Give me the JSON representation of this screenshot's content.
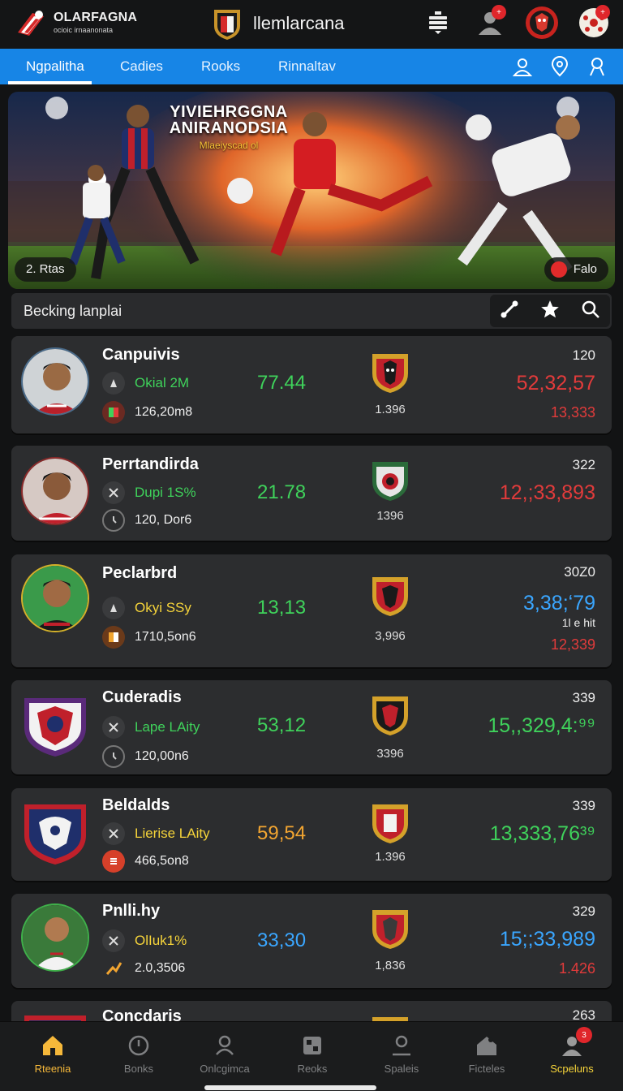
{
  "header": {
    "logo_title": "OLARFAGNA",
    "logo_subtitle": "ocioic irnaanonata",
    "brand_title": "llemlarcana",
    "icons": [
      "menu-stack-icon",
      "user-icon",
      "team-crest-icon",
      "ball-icon"
    ],
    "notification_badges": [
      "+",
      "+"
    ]
  },
  "tabs": {
    "items": [
      "Ngpalitha",
      "Cadies",
      "Rooks",
      "Rinnaltav"
    ],
    "active_index": 0,
    "icons": [
      "user-outline-icon",
      "location-icon",
      "profile-icon"
    ]
  },
  "banner": {
    "headline_1": "YIVIEHRGGNA",
    "headline_2": "ANIRANODSIA",
    "subline": "Mlaeiyscad ol",
    "left_pill": "2. Rtas",
    "right_pill": "Falo"
  },
  "section": {
    "title": "Becking lanplai",
    "tools": [
      "link-icon",
      "star-icon",
      "search-icon"
    ]
  },
  "players": [
    {
      "name": "Canpuivis",
      "tag": "Okial 2M",
      "tag_color": "#3fd25b",
      "stat": "126,20m8",
      "score": "77.44",
      "score_color": "#3fd25b",
      "badge_num": "1.396",
      "right_top": "120",
      "right_big": "52,32,57",
      "right_big_color": "#e23b3b",
      "right_small": "13,333",
      "right_small_color": "#e23b3b",
      "extra": ""
    },
    {
      "name": "Perrtandirda",
      "tag": "Dupi 1S%",
      "tag_color": "#3fd25b",
      "stat": "120, Dor6",
      "score": "21.78",
      "score_color": "#3fd25b",
      "badge_num": "1396",
      "right_top": "322",
      "right_big": "12,;33,893",
      "right_big_color": "#e23b3b",
      "right_small": "",
      "right_small_color": "#e23b3b",
      "extra": ""
    },
    {
      "name": "Peclarbrd",
      "tag": "Okyi SSy",
      "tag_color": "#f6d43a",
      "stat": "1710,5on6",
      "score": "13,13",
      "score_color": "#3fd25b",
      "badge_num": "3,996",
      "right_top": "30Z0",
      "right_big": "3,38;ʻ79",
      "right_big_color": "#3aa6ff",
      "right_small": "12,339",
      "right_small_color": "#e23b3b",
      "extra": "1l e hit"
    },
    {
      "name": "Cuderadis",
      "tag": "Lape LAity",
      "tag_color": "#3fd25b",
      "stat": "120,00n6",
      "score": "53,12",
      "score_color": "#3fd25b",
      "badge_num": "3396",
      "right_top": "339",
      "right_big": "15,,329,4:⁹⁹",
      "right_big_color": "#3fd25b",
      "right_small": "",
      "right_small_color": "#e23b3b",
      "extra": ""
    },
    {
      "name": "Beldalds",
      "tag": "Lierise LAity",
      "tag_color": "#f6d43a",
      "stat": "466,5on8",
      "score": "59,54",
      "score_color": "#f2a531",
      "badge_num": "1.396",
      "right_top": "339",
      "right_big": "13,333,76³⁹",
      "right_big_color": "#3fd25b",
      "right_small": "",
      "right_small_color": "#e23b3b",
      "extra": ""
    },
    {
      "name": "Pnlli.hy",
      "tag": "OlIuk1%",
      "tag_color": "#f6d43a",
      "stat": "2.0,3506",
      "score": "33,30",
      "score_color": "#3aa6ff",
      "badge_num": "1,836",
      "right_top": "329",
      "right_big": "15;;33,989",
      "right_big_color": "#3aa6ff",
      "right_small": "1.426",
      "right_small_color": "#e23b3b",
      "extra": ""
    },
    {
      "name": "Concdaris",
      "tag": "",
      "tag_color": "#3fd25b",
      "stat": "",
      "score": "",
      "score_color": "#3fd25b",
      "badge_num": "",
      "right_top": "263",
      "right_big": "",
      "right_big_color": "#3fd25b",
      "right_small": "",
      "right_small_color": "#e23b3b",
      "extra": ""
    }
  ],
  "bottom_nav": {
    "items": [
      "Rteenia",
      "Bonks",
      "Onlcgimca",
      "Reoks",
      "Spaleis",
      "Ficteles",
      "Scpeluns"
    ],
    "icons": [
      "home-icon",
      "timer-icon",
      "chat-icon",
      "grid-icon",
      "user-icon",
      "house-icon",
      "avatar-icon"
    ],
    "active_index": 0,
    "highlight_index": 6,
    "badge": "3"
  },
  "colors": {
    "accent_tab": "#1785e6",
    "active_nav": "#f6b83a",
    "positive": "#3fd25b",
    "negative": "#e23b3b",
    "info": "#3aa6ff"
  }
}
